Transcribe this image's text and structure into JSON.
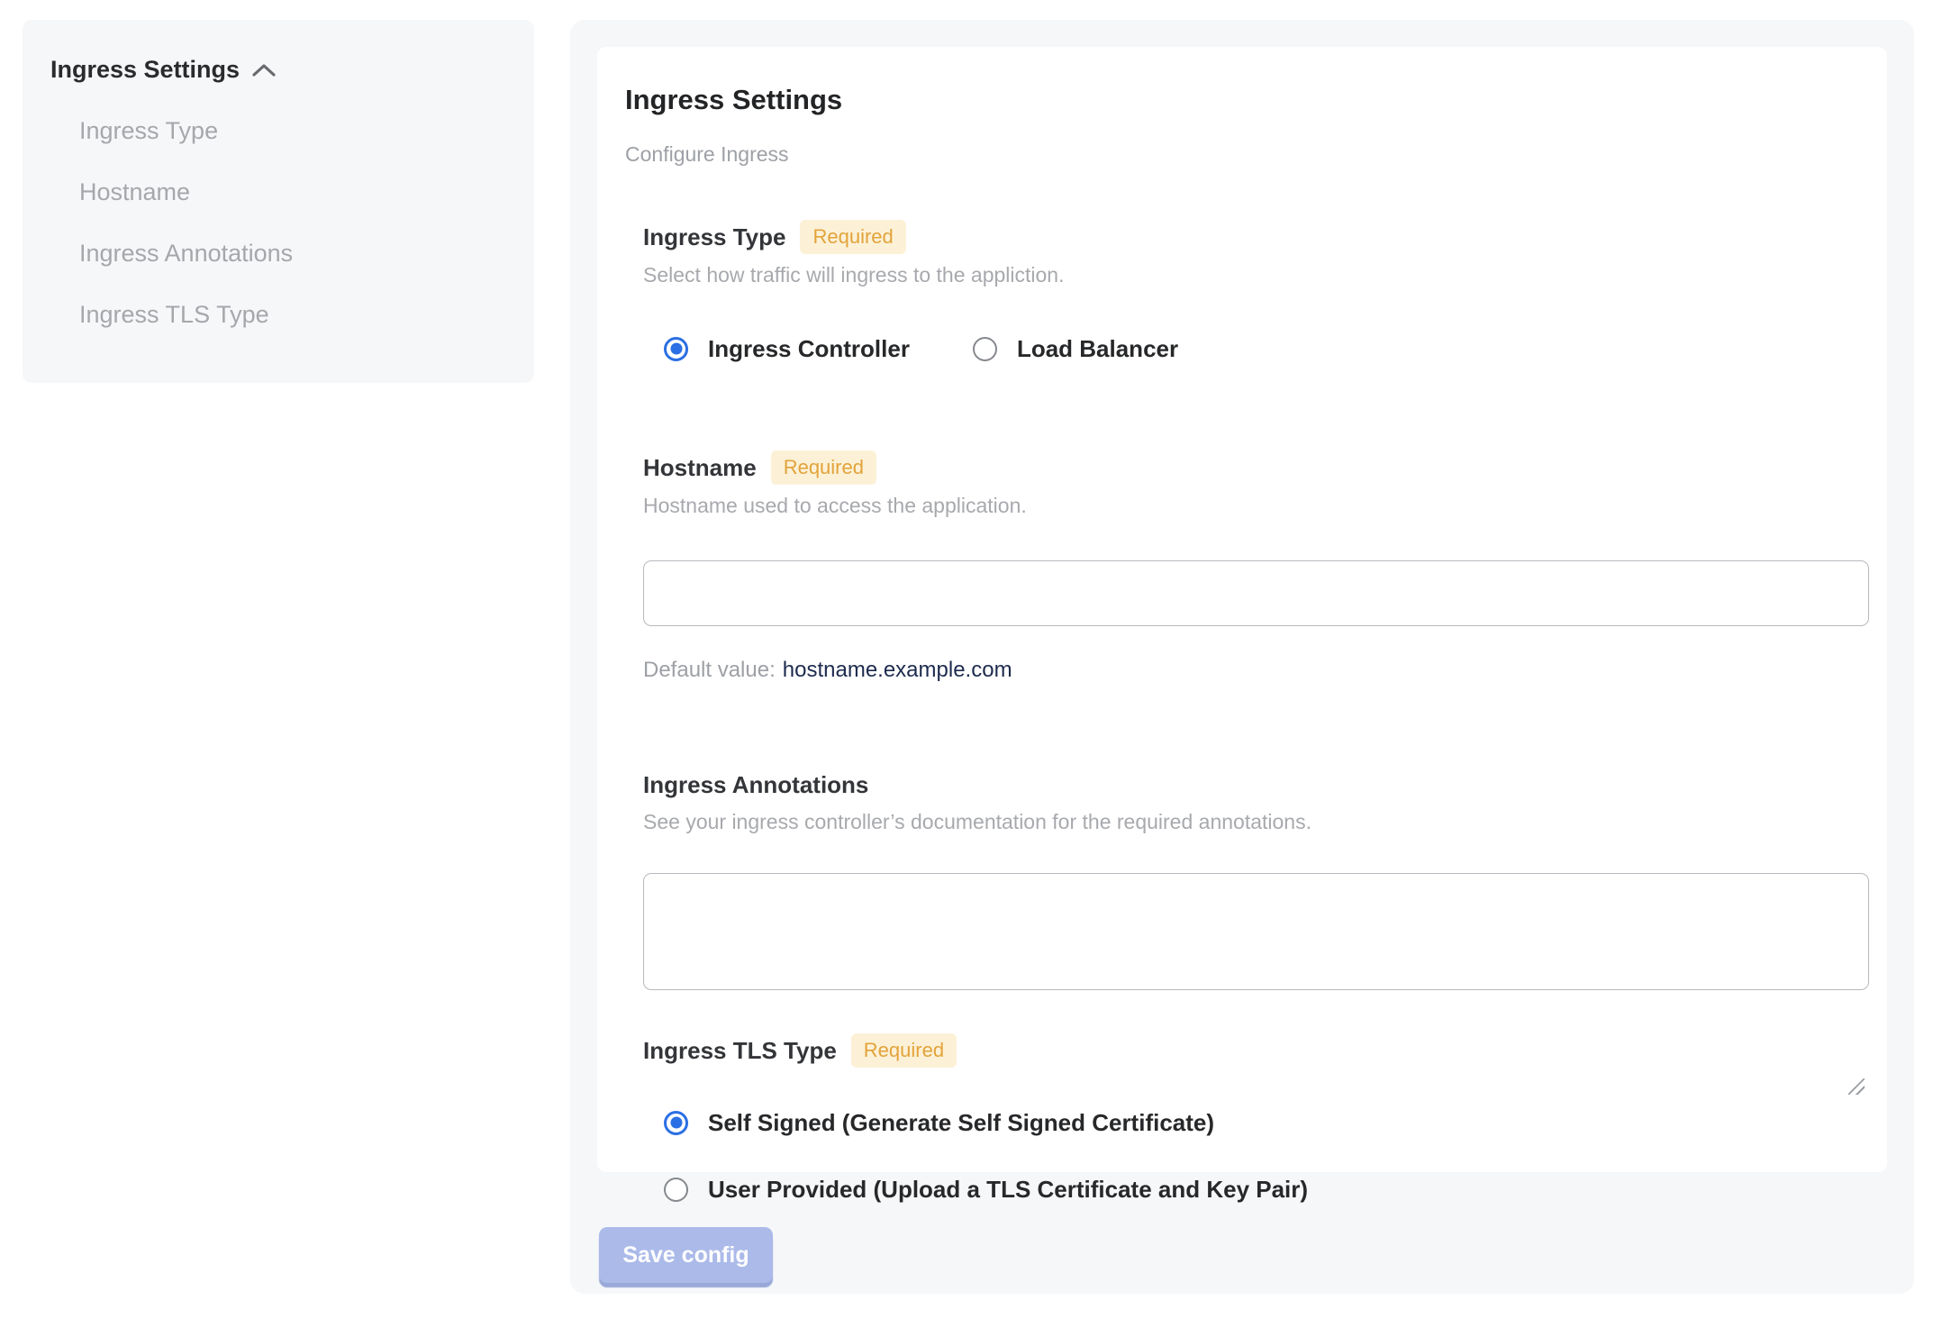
{
  "sidebar": {
    "title": "Ingress Settings",
    "items": [
      {
        "label": "Ingress Type"
      },
      {
        "label": "Hostname"
      },
      {
        "label": "Ingress Annotations"
      },
      {
        "label": "Ingress TLS Type"
      }
    ]
  },
  "main": {
    "title": "Ingress Settings",
    "subtitle": "Configure Ingress",
    "required_badge": "Required",
    "sections": {
      "ingress_type": {
        "label": "Ingress Type",
        "help": "Select how traffic will ingress to the appliction.",
        "options": [
          {
            "label": "Ingress Controller",
            "selected": true
          },
          {
            "label": "Load Balancer",
            "selected": false
          }
        ]
      },
      "hostname": {
        "label": "Hostname",
        "help": "Hostname used to access the application.",
        "value": "",
        "placeholder": "",
        "default_label": "Default value:",
        "default_value": "hostname.example.com"
      },
      "annotations": {
        "label": "Ingress Annotations",
        "help": "See your ingress controller’s documentation for the required annotations.",
        "value": ""
      },
      "tls_type": {
        "label": "Ingress TLS Type",
        "options": [
          {
            "label": "Self Signed (Generate Self Signed Certificate)",
            "selected": true
          },
          {
            "label": "User Provided (Upload a TLS Certificate and Key Pair)",
            "selected": false
          }
        ]
      }
    },
    "save_button": "Save config"
  },
  "colors": {
    "panel_bg": "#f6f7f9",
    "badge_bg": "#fcf1d7",
    "badge_text": "#e2a33a",
    "radio_selected": "#2b6fe4",
    "default_value_text": "#1d2b4e",
    "save_button_bg": "#abbae9",
    "input_border": "#b6b9be"
  }
}
